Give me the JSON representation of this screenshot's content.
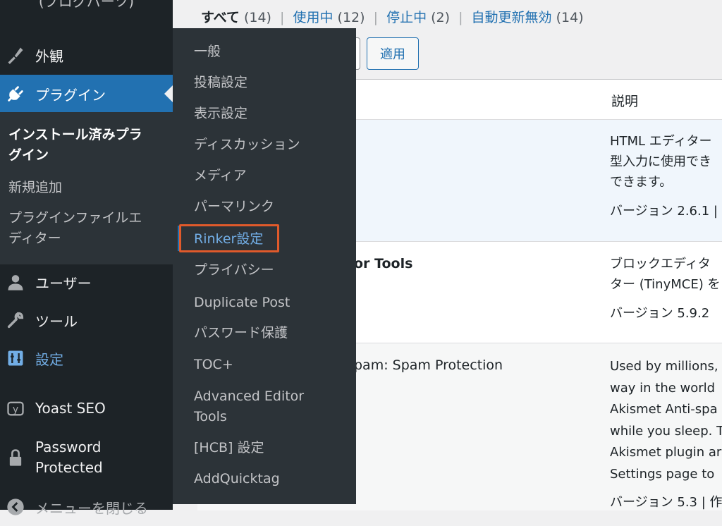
{
  "sidebar": {
    "top_item": "(ブログパーツ)",
    "menu": [
      {
        "label": "外観",
        "icon": "paintbrush-icon"
      },
      {
        "label": "プラグイン",
        "icon": "plugin-icon"
      },
      {
        "label": "ユーザー",
        "icon": "user-icon"
      },
      {
        "label": "ツール",
        "icon": "wrench-icon"
      },
      {
        "label": "設定",
        "icon": "settings-icon"
      },
      {
        "label": "Yoast SEO",
        "icon": "yoast-icon"
      },
      {
        "label": "Password",
        "label2": "Protected",
        "icon": "lock-icon"
      }
    ],
    "submenu": [
      {
        "label": "インストール済みプラ",
        "label2": "グイン"
      },
      {
        "label": "新規追加"
      },
      {
        "label": "プラグインファイルエ",
        "label2": "ディター"
      }
    ],
    "collapse_label": "メニューを閉じる"
  },
  "filters": {
    "all": "すべて",
    "all_count": "(14)",
    "active": "使用中",
    "active_count": "(12)",
    "inactive": "停止中",
    "inactive_count": "(2)",
    "autoupdate_off": "自動更新無効",
    "autoupdate_off_count": "(14)"
  },
  "apply_button": "適用",
  "table": {
    "description_header": "説明",
    "rows": [
      {
        "name": "",
        "desc_lines": [
          "HTML エディター",
          "型入力に使用でき",
          "できます。"
        ],
        "version": "バージョン 2.6.1 |"
      },
      {
        "name": "or Tools",
        "desc_lines": [
          "ブロックエディタ",
          "ター (TinyMCE) を"
        ],
        "version": "バージョン 5.9.2"
      },
      {
        "name": "pam: Spam Protection",
        "desc_lines": [
          "Used by millions,",
          "way in the world",
          "Akismet Anti-spa",
          "while you sleep. T",
          "Akismet plugin ar",
          "Settings page to"
        ],
        "version": "バージョン 5.3 | 作"
      }
    ]
  },
  "flyout": [
    "一般",
    "投稿設定",
    "表示設定",
    "ディスカッション",
    "メディア",
    "パーマリンク",
    "Rinker設定",
    "プライバシー",
    "Duplicate Post",
    "パスワード保護",
    "TOC+",
    "Advanced Editor",
    "Tools",
    "[HCB] 設定",
    "AddQuicktag"
  ],
  "colors": {
    "sidebar_bg": "#1d2327",
    "accent": "#2271b1",
    "highlight_box": "#e05a2b"
  }
}
